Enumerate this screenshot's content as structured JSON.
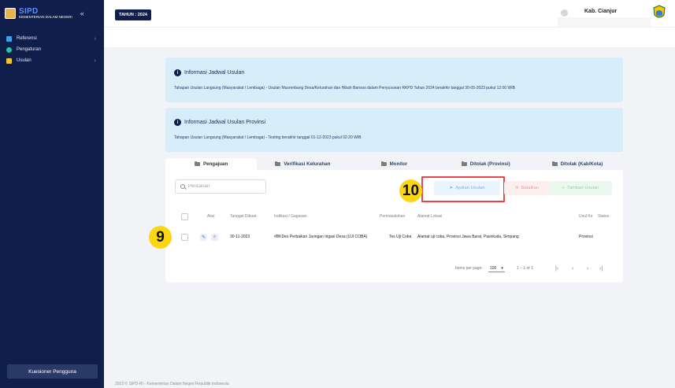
{
  "brand": {
    "title": "SIPD",
    "subtitle": "KEMENTERIAN DALAM NEGERI",
    "collapse_icon": "«"
  },
  "sidebar": {
    "items": [
      {
        "label": "Referensi",
        "icon": "list-icon",
        "color": "#3fa1e8",
        "chevron": "›"
      },
      {
        "label": "Pengaturan",
        "icon": "settings-icon",
        "color": "#27c4a7",
        "chevron": ""
      },
      {
        "label": "Usulan",
        "icon": "folder-icon",
        "color": "#f1c232",
        "chevron": "›"
      }
    ],
    "survey_button": "Kuesioner Pengguna"
  },
  "topbar": {
    "year": "TAHUN : 2024",
    "region": "Kab. Cianjur"
  },
  "info": [
    {
      "title": "Informasi Jadwal Usulan",
      "text": "Tahapan Usulan Langsung (Masyarakat / Lembaga) - Usulan Musrenbang Desa/Kelurahan dan Hibah Bansos dalam Penyusunan RKPD Tahun 2024 berakhir tanggal 30-05-2023 pukul 12:00 WIB"
    },
    {
      "title": "Informasi Jadwal Usulan Provinsi",
      "text": "Tahapan Usulan Langsung (Masyarakat / Lembaga) - Testing berakhir tanggal 01-12-2023 pukul 02:20 WIB"
    }
  ],
  "tabs": [
    {
      "label": "Pengajuan",
      "active": true
    },
    {
      "label": "Verifikasi Kelurahan",
      "active": false
    },
    {
      "label": "Monitor",
      "active": false
    },
    {
      "label": "Ditolak (Provinsi)",
      "active": false
    },
    {
      "label": "Ditolak (Kab/Kota)",
      "active": false
    }
  ],
  "search": {
    "placeholder": "Pencarian"
  },
  "buttons": {
    "ajukan": "Ajukan Usulan",
    "batalkan": "Batalkan",
    "tambah": "Tambah Usulan"
  },
  "markers": {
    "ajukan": "10",
    "row": "9"
  },
  "table": {
    "headers": [
      "Aksi",
      "Tanggal Dibuat",
      "Indikasi / Gagasan",
      "Permasalahan",
      "Alamat Lokasi",
      "Usul Ke",
      "Status"
    ],
    "rows": [
      {
        "tanggal": "30-11-2023",
        "indikasi": "#BKDes Perbaikan Jaringan Irigasi Desa (UJI COBA)",
        "permasalahan": "Tes Uji Coba",
        "alamat": "Alamat uji coba, Provinsi Jawa Barat, Pasirkuda, Simpang",
        "usul_ke": "Provinsi",
        "status": ""
      }
    ]
  },
  "pager": {
    "items_per_page_label": "Items per page:",
    "items_per_page": "100",
    "range": "1 – 1 of 1"
  },
  "footer": "2022 © SIPD-RI - Kementerian Dalam Negeri Republik Indonesia"
}
